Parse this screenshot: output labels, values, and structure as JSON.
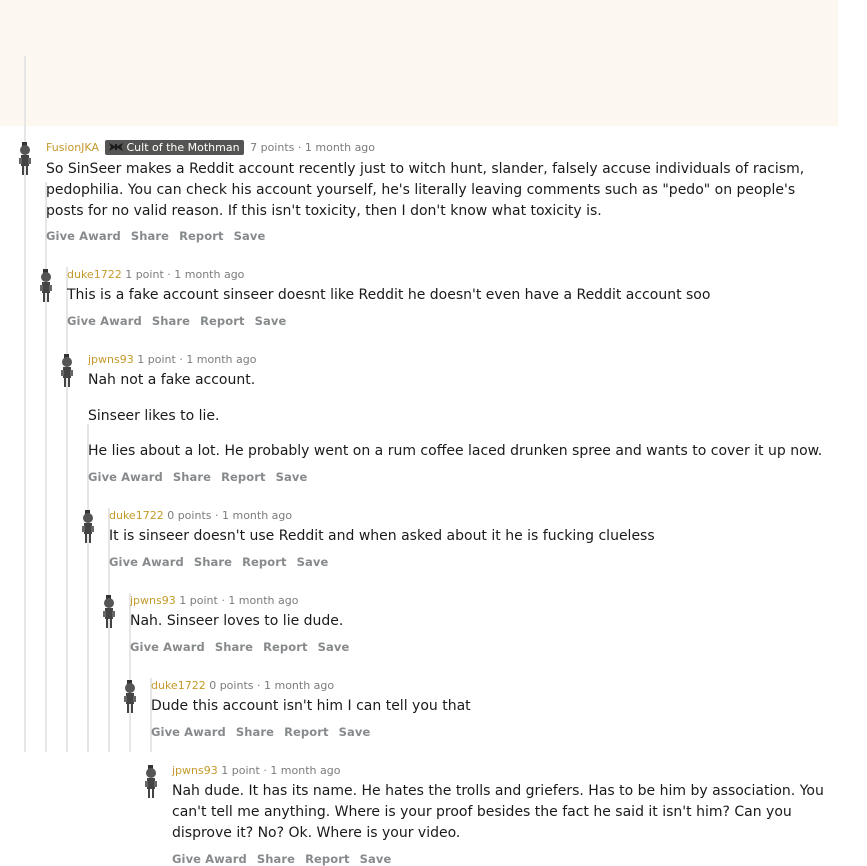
{
  "actions": [
    "Give Award",
    "Share",
    "Report",
    "Save"
  ],
  "comments": [
    {
      "author": "FusionJKA",
      "flair": "Cult of the Mothman",
      "score": "7 points",
      "sep": "·",
      "time": "1 month ago",
      "paragraphs": [
        "So SinSeer makes a Reddit account recently just to witch hunt, slander, falsely accuse individuals of racism, pedophilia. You can check his account yourself, he's literally leaving comments such as \"pedo\" on people's posts for no valid reason. If this isn't toxicity, then I don't know what toxicity is."
      ]
    },
    {
      "author": "duke1722",
      "score": "1 point",
      "sep": "·",
      "time": "1 month ago",
      "paragraphs": [
        "This is a fake account sinseer doesnt like Reddit he doesn't even have a Reddit account soo"
      ]
    },
    {
      "author": "jpwns93",
      "score": "1 point",
      "sep": "·",
      "time": "1 month ago",
      "paragraphs": [
        "Nah not a fake account.",
        "Sinseer likes to lie.",
        "He lies about a lot. He probably went on a rum coffee laced drunken spree and wants to cover it up now."
      ]
    },
    {
      "author": "duke1722",
      "score": "0 points",
      "sep": "·",
      "time": "1 month ago",
      "paragraphs": [
        "It is sinseer doesn't use Reddit and when asked about it he is fucking clueless"
      ]
    },
    {
      "author": "jpwns93",
      "score": "1 point",
      "sep": "·",
      "time": "1 month ago",
      "paragraphs": [
        "Nah. Sinseer loves to lie dude."
      ]
    },
    {
      "author": "duke1722",
      "score": "0 points",
      "sep": "·",
      "time": "1 month ago",
      "paragraphs": [
        "Dude this account isn't him I can tell you that"
      ]
    },
    {
      "author": "jpwns93",
      "score": "1 point",
      "sep": "·",
      "time": "1 month ago",
      "paragraphs": [
        "Nah dude. It has its name. He hates the trolls and griefers. Has to be him by association. You can't tell me anything. Where is your proof besides the fact he said it isn't him? Can you disprove it? No? Ok. Where is your video."
      ]
    }
  ],
  "colors": {
    "author": "#c49a2b",
    "meta": "#7c7c7c",
    "highlight_bg": "#fcf8ef",
    "thread_line": "#e6e6e6",
    "actions": "#878a8c"
  }
}
